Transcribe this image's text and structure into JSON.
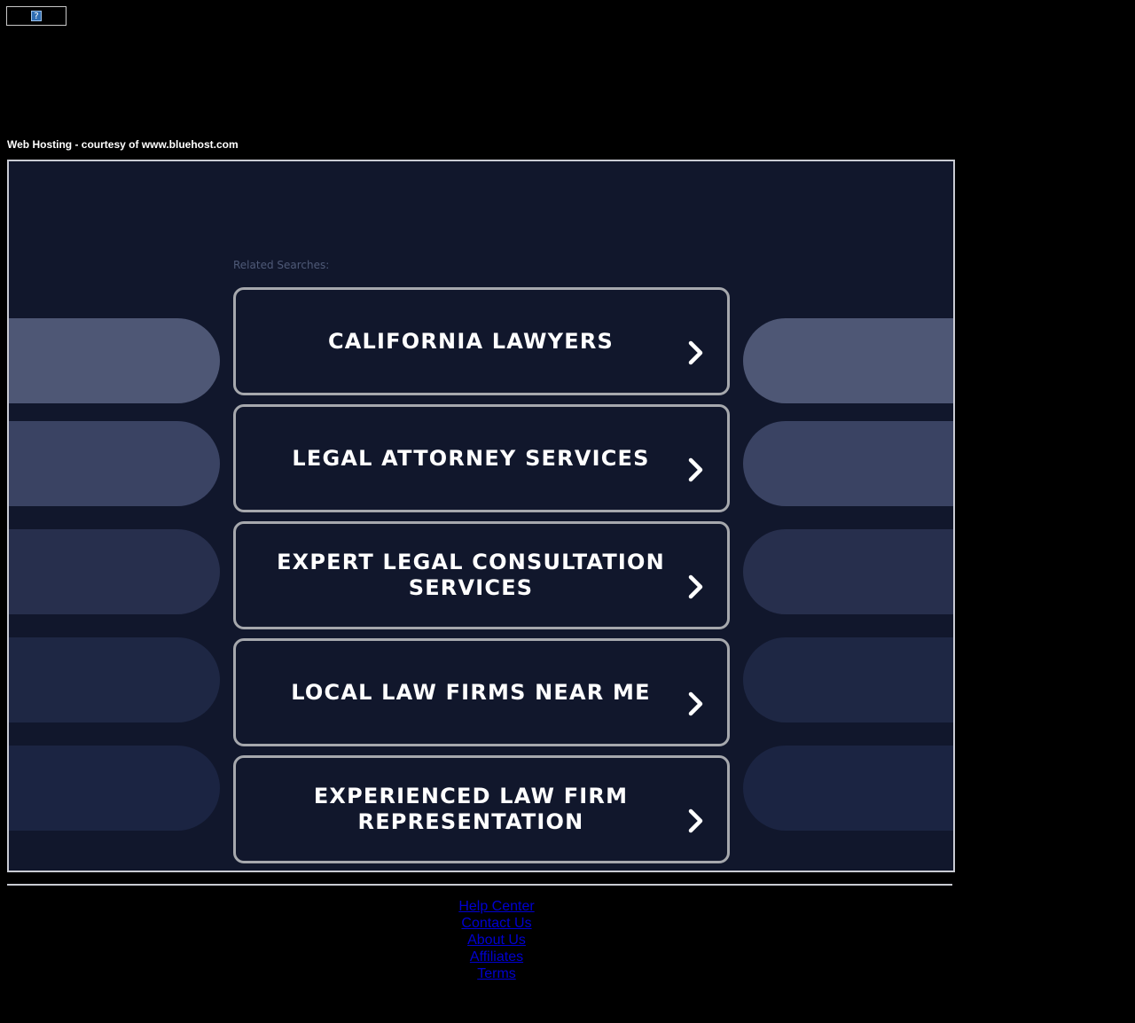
{
  "broken_image_glyph": "?",
  "hosting_note": "Web Hosting - courtesy of www.bluehost.com",
  "related_label": "Related Searches:",
  "searches": [
    {
      "label": "CALIFORNIA LAWYERS"
    },
    {
      "label": "LEGAL ATTORNEY SERVICES"
    },
    {
      "label": "EXPERT LEGAL CONSULTATION SERVICES"
    },
    {
      "label": "LOCAL LAW FIRMS NEAR ME"
    },
    {
      "label": "EXPERIENCED LAW FIRM REPRESENTATION"
    }
  ],
  "footer_links": [
    "Help Center",
    "Contact Us",
    "About Us",
    "Affiliates",
    "Terms"
  ],
  "colors": {
    "page_bg": "#000000",
    "panel_bg": "#11172c",
    "button_border": "#a6a8ad",
    "link": "#0000d0",
    "pill_row_1": "#4e5775",
    "pill_row_2": "#3a4363",
    "pill_row_3": "#272f4d",
    "pill_row_4": "#1e2744",
    "pill_row_5": "#1b2442"
  },
  "icons": {
    "chevron": "chevron-right-icon",
    "broken_image": "broken-image-icon"
  }
}
